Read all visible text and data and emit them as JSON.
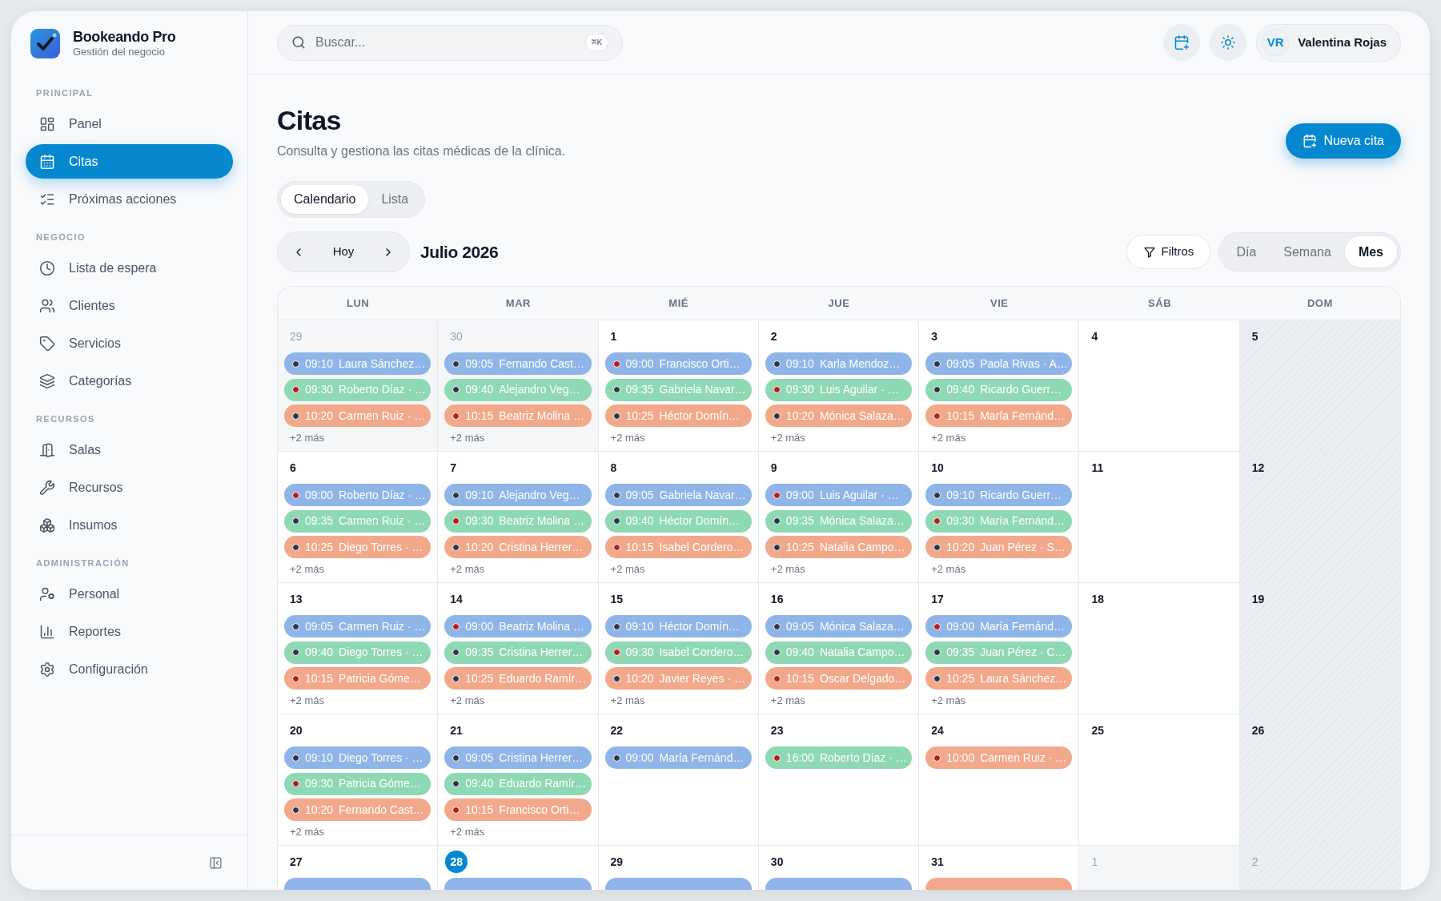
{
  "app": {
    "name": "Bookeando Pro",
    "tagline": "Gestión del negocio"
  },
  "sidebar": {
    "sections": [
      {
        "label": "PRINCIPAL",
        "items": [
          {
            "label": "Panel",
            "selected": false
          },
          {
            "label": "Citas",
            "selected": true
          },
          {
            "label": "Próximas acciones",
            "selected": false
          }
        ]
      },
      {
        "label": "NEGOCIO",
        "items": [
          {
            "label": "Lista de espera",
            "selected": false
          },
          {
            "label": "Clientes",
            "selected": false
          },
          {
            "label": "Servicios",
            "selected": false
          },
          {
            "label": "Categorías",
            "selected": false
          }
        ]
      },
      {
        "label": "RECURSOS",
        "items": [
          {
            "label": "Salas",
            "selected": false
          },
          {
            "label": "Recursos",
            "selected": false
          },
          {
            "label": "Insumos",
            "selected": false
          }
        ]
      },
      {
        "label": "ADMINISTRACIÓN",
        "items": [
          {
            "label": "Personal",
            "selected": false
          },
          {
            "label": "Reportes",
            "selected": false
          },
          {
            "label": "Configuración",
            "selected": false
          }
        ]
      }
    ]
  },
  "search": {
    "placeholder": "Buscar...",
    "shortcut": "⌘K"
  },
  "user": {
    "initials": "VR",
    "name": "Valentina Rojas"
  },
  "page": {
    "title": "Citas",
    "subtitle": "Consulta y gestiona las citas médicas de la clínica.",
    "primary_button": "Nueva cita"
  },
  "view_tabs": [
    {
      "label": "Calendario",
      "selected": true
    },
    {
      "label": "Lista",
      "selected": false
    }
  ],
  "toolbar": {
    "today_button": "Hoy",
    "period": "Julio 2026",
    "filter_button": "Filtros",
    "ranges": [
      {
        "label": "Día",
        "selected": false
      },
      {
        "label": "Semana",
        "selected": false
      },
      {
        "label": "Mes",
        "selected": true
      }
    ]
  },
  "calendar": {
    "weekdays": [
      {
        "label": "LUN",
        "shaded": false
      },
      {
        "label": "MAR",
        "shaded": false
      },
      {
        "label": "MIÉ",
        "shaded": false
      },
      {
        "label": "JUE",
        "shaded": false
      },
      {
        "label": "VIE",
        "shaded": false
      },
      {
        "label": "SÁB",
        "shaded": false
      },
      {
        "label": "DOM",
        "shaded": true
      }
    ],
    "weeks": [
      [
        {
          "day": "29",
          "outside": true,
          "today": false,
          "events": [
            {
              "time": "09:10",
              "name": "Laura Sánchez…",
              "color": "#8fb5e8",
              "status": {
                "color": "#2d3748"
              }
            },
            {
              "time": "09:30",
              "name": "Roberto Díaz · …",
              "color": "#8ed9b4",
              "status": {
                "color": "#b91c1c"
              }
            },
            {
              "time": "10:20",
              "name": "Carmen Ruiz · …",
              "color": "#f2a98b",
              "status": {
                "color": "#2d3748"
              }
            }
          ],
          "more": "+2 más"
        },
        {
          "day": "30",
          "outside": true,
          "today": false,
          "events": [
            {
              "time": "09:05",
              "name": "Fernando Cast…",
              "color": "#8fb5e8",
              "status": {
                "color": "#2d3748"
              }
            },
            {
              "time": "09:40",
              "name": "Alejandro Veg…",
              "color": "#8ed9b4",
              "status": {
                "color": "#2d3748"
              }
            },
            {
              "time": "10:15",
              "name": "Beatriz Molina …",
              "color": "#f2a98b",
              "status": {
                "color": "#b91c1c"
              }
            }
          ],
          "more": "+2 más"
        },
        {
          "day": "1",
          "outside": false,
          "today": false,
          "events": [
            {
              "time": "09:00",
              "name": "Francisco Orti…",
              "color": "#8fb5e8",
              "status": {
                "color": "#b91c1c"
              }
            },
            {
              "time": "09:35",
              "name": "Gabriela Navar…",
              "color": "#8ed9b4",
              "status": {
                "color": "#2d3748"
              }
            },
            {
              "time": "10:25",
              "name": "Héctor Domín…",
              "color": "#f2a98b",
              "status": {
                "color": "#2d3748"
              }
            }
          ],
          "more": "+2 más"
        },
        {
          "day": "2",
          "outside": false,
          "today": false,
          "events": [
            {
              "time": "09:10",
              "name": "Karla Mendoz…",
              "color": "#8fb5e8",
              "status": {
                "color": "#2d3748"
              }
            },
            {
              "time": "09:30",
              "name": "Luis Aguilar · …",
              "color": "#8ed9b4",
              "status": {
                "color": "#b91c1c"
              }
            },
            {
              "time": "10:20",
              "name": "Mónica Salaza…",
              "color": "#f2a98b",
              "status": {
                "color": "#2d3748"
              }
            }
          ],
          "more": "+2 más"
        },
        {
          "day": "3",
          "outside": false,
          "today": false,
          "events": [
            {
              "time": "09:05",
              "name": "Paola Rivas · A…",
              "color": "#8fb5e8",
              "status": {
                "color": "#2d3748"
              }
            },
            {
              "time": "09:40",
              "name": "Ricardo Guerr…",
              "color": "#8ed9b4",
              "status": {
                "color": "#2d3748"
              }
            },
            {
              "time": "10:15",
              "name": "María Fernánd…",
              "color": "#f2a98b",
              "status": {
                "color": "#b91c1c"
              }
            }
          ],
          "more": "+2 más"
        },
        {
          "day": "4",
          "outside": false,
          "today": false
        },
        {
          "day": "5",
          "outside": false,
          "today": false
        }
      ],
      [
        {
          "day": "6",
          "outside": false,
          "today": false,
          "events": [
            {
              "time": "09:00",
              "name": "Roberto Díaz · …",
              "color": "#8fb5e8",
              "status": {
                "color": "#b91c1c"
              }
            },
            {
              "time": "09:35",
              "name": "Carmen Ruiz · …",
              "color": "#8ed9b4",
              "status": {
                "color": "#2d3748"
              }
            },
            {
              "time": "10:25",
              "name": "Diego Torres · …",
              "color": "#f2a98b",
              "status": {
                "color": "#2d3748"
              }
            }
          ],
          "more": "+2 más"
        },
        {
          "day": "7",
          "outside": false,
          "today": false,
          "events": [
            {
              "time": "09:10",
              "name": "Alejandro Veg…",
              "color": "#8fb5e8",
              "status": {
                "color": "#2d3748"
              }
            },
            {
              "time": "09:30",
              "name": "Beatriz Molina …",
              "color": "#8ed9b4",
              "status": {
                "color": "#b91c1c"
              }
            },
            {
              "time": "10:20",
              "name": "Cristina Herrer…",
              "color": "#f2a98b",
              "status": {
                "color": "#2d3748"
              }
            }
          ],
          "more": "+2 más"
        },
        {
          "day": "8",
          "outside": false,
          "today": false,
          "events": [
            {
              "time": "09:05",
              "name": "Gabriela Navar…",
              "color": "#8fb5e8",
              "status": {
                "color": "#2d3748"
              }
            },
            {
              "time": "09:40",
              "name": "Héctor Domín…",
              "color": "#8ed9b4",
              "status": {
                "color": "#2d3748"
              }
            },
            {
              "time": "10:15",
              "name": "Isabel Cordero…",
              "color": "#f2a98b",
              "status": {
                "color": "#b91c1c"
              }
            }
          ],
          "more": "+2 más"
        },
        {
          "day": "9",
          "outside": false,
          "today": false,
          "events": [
            {
              "time": "09:00",
              "name": "Luis Aguilar · …",
              "color": "#8fb5e8",
              "status": {
                "color": "#b91c1c"
              }
            },
            {
              "time": "09:35",
              "name": "Mónica Salaza…",
              "color": "#8ed9b4",
              "status": {
                "color": "#2d3748"
              }
            },
            {
              "time": "10:25",
              "name": "Natalia Campo…",
              "color": "#f2a98b",
              "status": {
                "color": "#2d3748"
              }
            }
          ],
          "more": "+2 más"
        },
        {
          "day": "10",
          "outside": false,
          "today": false,
          "events": [
            {
              "time": "09:10",
              "name": "Ricardo Guerr…",
              "color": "#8fb5e8",
              "status": {
                "color": "#2d3748"
              }
            },
            {
              "time": "09:30",
              "name": "María Fernánd…",
              "color": "#8ed9b4",
              "status": {
                "color": "#b91c1c"
              }
            },
            {
              "time": "10:20",
              "name": "Juan Pérez · S…",
              "color": "#f2a98b",
              "status": {
                "color": "#2d3748"
              }
            }
          ],
          "more": "+2 más"
        },
        {
          "day": "11",
          "outside": false,
          "today": false
        },
        {
          "day": "12",
          "outside": false,
          "today": false
        }
      ],
      [
        {
          "day": "13",
          "outside": false,
          "today": false,
          "events": [
            {
              "time": "09:05",
              "name": "Carmen Ruiz · …",
              "color": "#8fb5e8",
              "status": {
                "color": "#2d3748"
              }
            },
            {
              "time": "09:40",
              "name": "Diego Torres · …",
              "color": "#8ed9b4",
              "status": {
                "color": "#2d3748"
              }
            },
            {
              "time": "10:15",
              "name": "Patricia Góme…",
              "color": "#f2a98b",
              "status": {
                "color": "#b91c1c"
              }
            }
          ],
          "more": "+2 más"
        },
        {
          "day": "14",
          "outside": false,
          "today": false,
          "events": [
            {
              "time": "09:00",
              "name": "Beatriz Molina …",
              "color": "#8fb5e8",
              "status": {
                "color": "#b91c1c"
              }
            },
            {
              "time": "09:35",
              "name": "Cristina Herrer…",
              "color": "#8ed9b4",
              "status": {
                "color": "#2d3748"
              }
            },
            {
              "time": "10:25",
              "name": "Eduardo Ramír…",
              "color": "#f2a98b",
              "status": {
                "color": "#2d3748"
              }
            }
          ],
          "more": "+2 más"
        },
        {
          "day": "15",
          "outside": false,
          "today": false,
          "events": [
            {
              "time": "09:10",
              "name": "Héctor Domín…",
              "color": "#8fb5e8",
              "status": {
                "color": "#2d3748"
              }
            },
            {
              "time": "09:30",
              "name": "Isabel Cordero…",
              "color": "#8ed9b4",
              "status": {
                "color": "#b91c1c"
              }
            },
            {
              "time": "10:20",
              "name": "Javier Reyes · …",
              "color": "#f2a98b",
              "status": {
                "color": "#2d3748"
              }
            }
          ],
          "more": "+2 más"
        },
        {
          "day": "16",
          "outside": false,
          "today": false,
          "events": [
            {
              "time": "09:05",
              "name": "Mónica Salaza…",
              "color": "#8fb5e8",
              "status": {
                "color": "#2d3748"
              }
            },
            {
              "time": "09:40",
              "name": "Natalia Campo…",
              "color": "#8ed9b4",
              "status": {
                "color": "#2d3748"
              }
            },
            {
              "time": "10:15",
              "name": "Oscar Delgado…",
              "color": "#f2a98b",
              "status": {
                "color": "#b91c1c"
              }
            }
          ],
          "more": "+2 más"
        },
        {
          "day": "17",
          "outside": false,
          "today": false,
          "events": [
            {
              "time": "09:00",
              "name": "María Fernánd…",
              "color": "#8fb5e8",
              "status": {
                "color": "#b91c1c"
              }
            },
            {
              "time": "09:35",
              "name": "Juan Pérez · C…",
              "color": "#8ed9b4",
              "status": {
                "color": "#2d3748"
              }
            },
            {
              "time": "10:25",
              "name": "Laura Sánchez…",
              "color": "#f2a98b",
              "status": {
                "color": "#2d3748"
              }
            }
          ],
          "more": "+2 más"
        },
        {
          "day": "18",
          "outside": false,
          "today": false
        },
        {
          "day": "19",
          "outside": false,
          "today": false
        }
      ],
      [
        {
          "day": "20",
          "outside": false,
          "today": false,
          "events": [
            {
              "time": "09:10",
              "name": "Diego Torres · …",
              "color": "#8fb5e8",
              "status": {
                "color": "#2d3748"
              }
            },
            {
              "time": "09:30",
              "name": "Patricia Góme…",
              "color": "#8ed9b4",
              "status": {
                "color": "#b91c1c"
              }
            },
            {
              "time": "10:20",
              "name": "Fernando Cast…",
              "color": "#f2a98b",
              "status": {
                "color": "#2d3748"
              }
            }
          ],
          "more": "+2 más"
        },
        {
          "day": "21",
          "outside": false,
          "today": false,
          "events": [
            {
              "time": "09:05",
              "name": "Cristina Herrer…",
              "color": "#8fb5e8",
              "status": {
                "color": "#2d3748"
              }
            },
            {
              "time": "09:40",
              "name": "Eduardo Ramír…",
              "color": "#8ed9b4",
              "status": {
                "color": "#2d3748"
              }
            },
            {
              "time": "10:15",
              "name": "Francisco Orti…",
              "color": "#f2a98b",
              "status": {
                "color": "#b91c1c"
              }
            }
          ],
          "more": "+2 más"
        },
        {
          "day": "22",
          "outside": false,
          "today": false,
          "events": [
            {
              "time": "09:00",
              "name": "María Fernánd…",
              "color": "#8fb5e8",
              "status": {
                "color": "#2d3748"
              }
            }
          ]
        },
        {
          "day": "23",
          "outside": false,
          "today": false,
          "events": [
            {
              "time": "16:00",
              "name": "Roberto Díaz · …",
              "color": "#8ed9b4",
              "status": {
                "color": "#b91c1c"
              }
            }
          ]
        },
        {
          "day": "24",
          "outside": false,
          "today": false,
          "events": [
            {
              "time": "10:00",
              "name": "Carmen Ruiz · …",
              "color": "#f2a98b",
              "status": {
                "color": "#b91c1c"
              }
            }
          ]
        },
        {
          "day": "25",
          "outside": false,
          "today": false
        },
        {
          "day": "26",
          "outside": false,
          "today": false
        }
      ],
      [
        {
          "day": "27",
          "outside": false,
          "today": false,
          "events": [
            {
              "color": "#8fb5e8"
            }
          ]
        },
        {
          "day": "28",
          "outside": false,
          "today": true,
          "events": [
            {
              "color": "#8fb5e8"
            }
          ]
        },
        {
          "day": "29",
          "outside": false,
          "today": false,
          "events": [
            {
              "color": "#8fb5e8"
            }
          ]
        },
        {
          "day": "30",
          "outside": false,
          "today": false,
          "events": [
            {
              "color": "#8fb5e8"
            }
          ]
        },
        {
          "day": "31",
          "outside": false,
          "today": false,
          "events": [
            {
              "color": "#f2a98b"
            }
          ]
        },
        {
          "day": "1",
          "outside": true,
          "today": false
        },
        {
          "day": "2",
          "outside": true,
          "today": false
        }
      ]
    ]
  }
}
